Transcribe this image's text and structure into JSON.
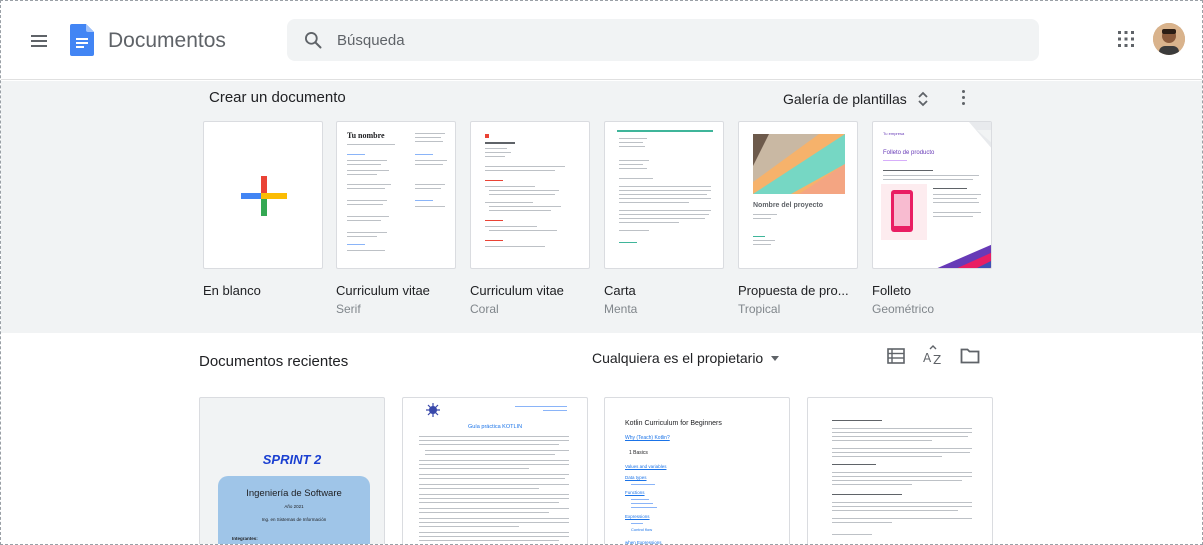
{
  "header": {
    "app_title": "Documentos",
    "search_placeholder": "Búsqueda",
    "icons": [
      "menu-icon",
      "docs-logo",
      "search-icon",
      "apps-icon",
      "account-avatar"
    ]
  },
  "templates": {
    "heading": "Crear un documento",
    "gallery_label": "Galería de plantillas",
    "items": [
      {
        "name": "En blanco",
        "sub": ""
      },
      {
        "name": "Curriculum vitae",
        "sub": "Serif",
        "thumb_title": "Tu nombre"
      },
      {
        "name": "Curriculum vitae",
        "sub": "Coral"
      },
      {
        "name": "Carta",
        "sub": "Menta"
      },
      {
        "name": "Propuesta de pro...",
        "sub": "Tropical",
        "thumb_title": "Nombre del proyecto"
      },
      {
        "name": "Folleto",
        "sub": "Geométrico",
        "thumb_title": "Folleto de producto",
        "thumb_label": "Tu empresa"
      }
    ]
  },
  "recent": {
    "title": "Documentos recientes",
    "owner_filter": "Cualquiera es el propietario",
    "docs": [
      {
        "heading": "SPRINT 2",
        "box_title": "Ingeniería de Software",
        "box_lines": [
          "Año 2021",
          "Ing. en Sistemas de Información"
        ],
        "footer": "Integrantes:"
      },
      {
        "heading": "Guía práctica KOTLIN"
      },
      {
        "heading": "Kotlin Curriculum for Beginners",
        "links": [
          "Why (Teach) Kotlin?",
          "1 Basics",
          "Values and variables",
          "Data types",
          "Functions",
          "Expressions",
          "Control flow",
          "when Expressions"
        ]
      },
      {
        "heading": ""
      }
    ]
  },
  "colors": {
    "accent_blue": "#4285f4",
    "google_red": "#ea4335",
    "google_yellow": "#fbbc04",
    "google_green": "#34a853",
    "sprint_blue": "#1a3fd1",
    "panel_bg": "#f1f3f4"
  }
}
